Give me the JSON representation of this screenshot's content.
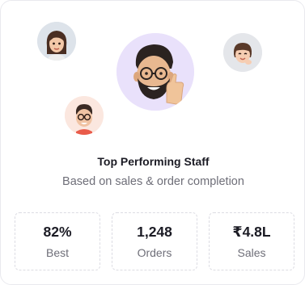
{
  "card": {
    "title": "Top Performing Staff",
    "subtitle": "Based on sales & order completion"
  },
  "avatars": [
    {
      "name": "woman-avatar-icon",
      "bg": "#dde3ea"
    },
    {
      "name": "bearded-man-thumbs-up-avatar-icon",
      "bg": "#e9e1fb"
    },
    {
      "name": "girl-avatar-icon",
      "bg": "#e4e6ea"
    },
    {
      "name": "man-glasses-avatar-icon",
      "bg": "#fbe7df"
    }
  ],
  "stats": [
    {
      "value": "82%",
      "label": "Best"
    },
    {
      "value": "1,248",
      "label": "Orders"
    },
    {
      "value": "₹4.8L",
      "label": "Sales"
    }
  ]
}
